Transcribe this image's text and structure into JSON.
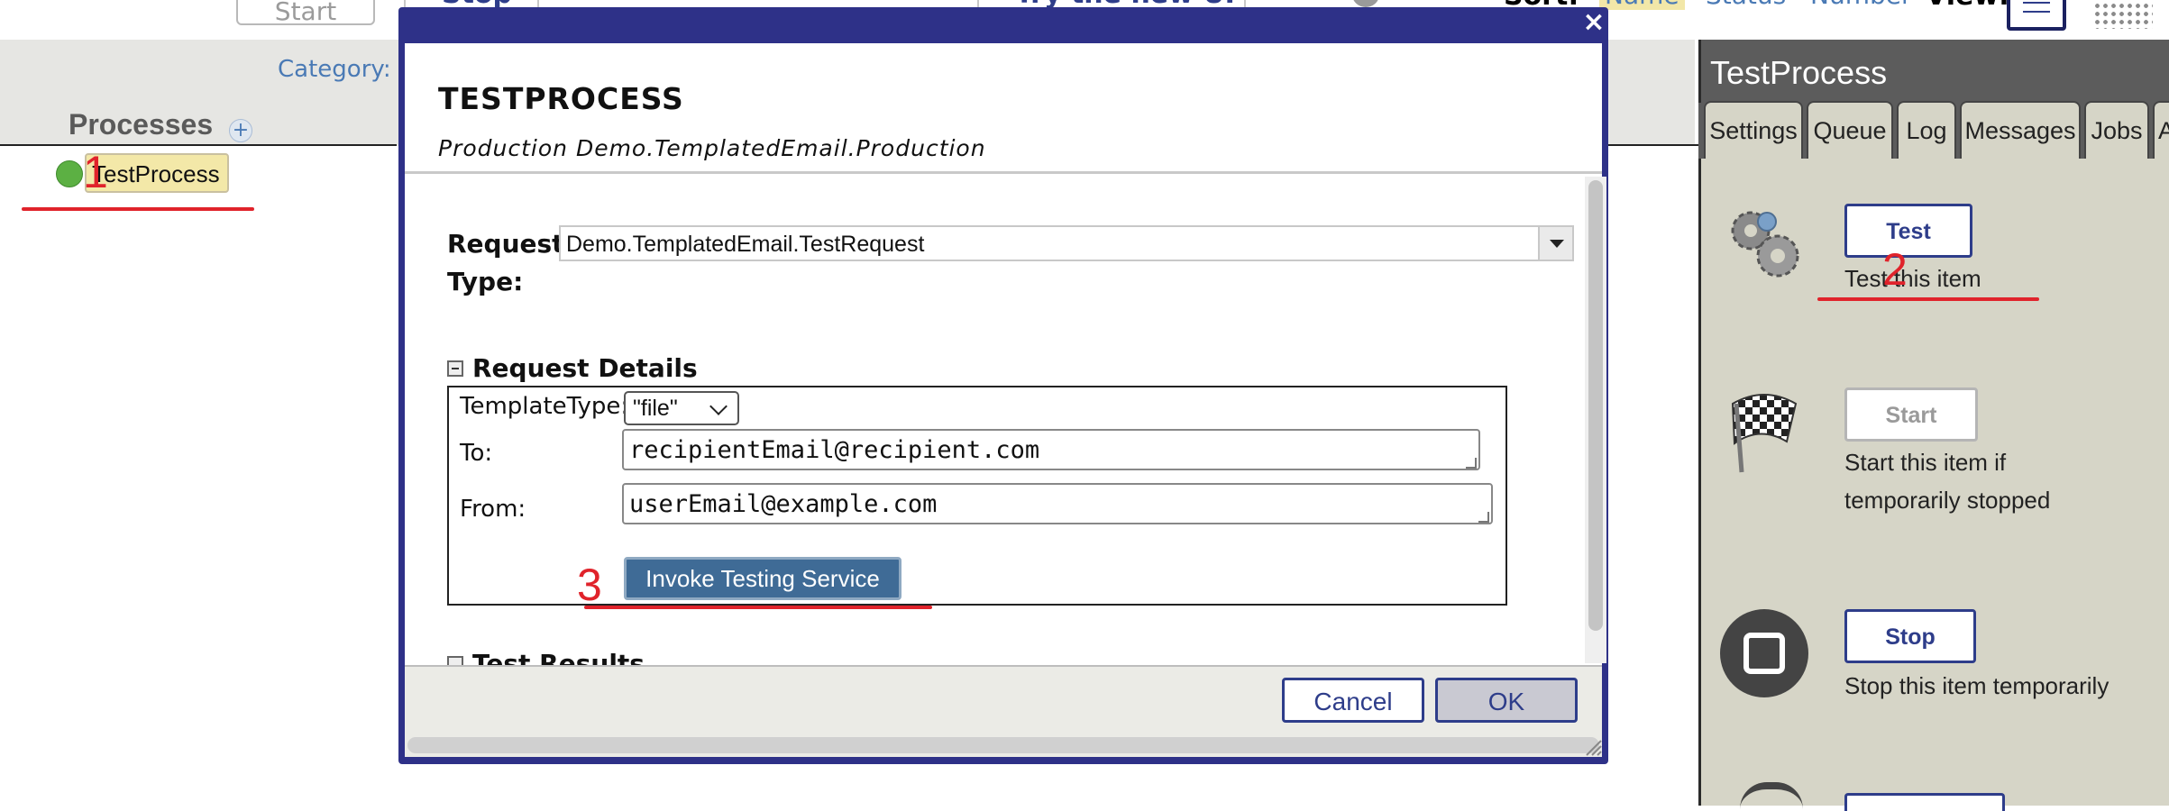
{
  "toolbar": {
    "start_label": "Start",
    "stop_label": "Stop",
    "try_new_ui_label": "Try the new UI",
    "sort_label": "Sort:",
    "sort_options": [
      "Name",
      "Status",
      "Number"
    ],
    "view_label": "View:"
  },
  "left_panel": {
    "category_label": "Category:",
    "processes_title": "Processes",
    "add_icon": "plus-icon",
    "items": [
      {
        "name": "TestProcess",
        "status_color": "#5cb043"
      }
    ]
  },
  "annotations": [
    "1",
    "2",
    "3"
  ],
  "right_panel": {
    "title": "TestProcess",
    "tabs": [
      "Settings",
      "Queue",
      "Log",
      "Messages",
      "Jobs",
      "A"
    ],
    "actions": [
      {
        "button": "Test",
        "description": "Test this item",
        "icon": "gears-icon",
        "enabled": true
      },
      {
        "button": "Start",
        "description_lines": [
          "Start this item if",
          "temporarily stopped"
        ],
        "icon": "checkered-flag-icon",
        "enabled": false
      },
      {
        "button": "Stop",
        "description": "Stop this item temporarily",
        "icon": "stop-icon",
        "enabled": true
      }
    ]
  },
  "modal": {
    "title": "TESTPROCESS",
    "subtitle": "Production Demo.TemplatedEmail.Production",
    "close_glyph": "×",
    "request_type_label_line1": "Request",
    "request_type_label_line2": "Type:",
    "request_type_value": "Demo.TemplatedEmail.TestRequest",
    "request_details_title": "Request Details",
    "fields": {
      "template_type_label": "TemplateType:",
      "template_type_value": "\"file\"",
      "to_label": "To:",
      "to_value": "recipientEmail@recipient.com",
      "from_label": "From:",
      "from_value": "userEmail@example.com"
    },
    "invoke_button": "Invoke Testing Service",
    "test_results_title": "Test Results",
    "cancel_button": "Cancel",
    "ok_button": "OK"
  },
  "colors": {
    "accent": "#2e3188",
    "annotation": "#e0232b",
    "status_ok": "#5cb043",
    "invoke_button": "#3f6b96"
  }
}
